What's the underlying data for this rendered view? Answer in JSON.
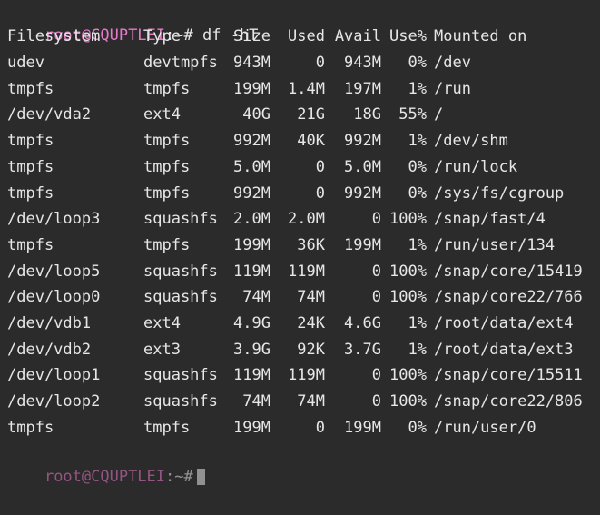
{
  "prompt": {
    "user_host": "root@CQUPTLEI",
    "separator": ":~",
    "symbol": "#",
    "command": "df -hT"
  },
  "table": {
    "headers": [
      "Filesystem",
      "Type",
      "Size",
      "Used",
      "Avail",
      "Use%",
      "Mounted on"
    ],
    "rows": [
      [
        "udev",
        "devtmpfs",
        "943M",
        "0",
        "943M",
        "0%",
        "/dev"
      ],
      [
        "tmpfs",
        "tmpfs",
        "199M",
        "1.4M",
        "197M",
        "1%",
        "/run"
      ],
      [
        "/dev/vda2",
        "ext4",
        "40G",
        "21G",
        "18G",
        "55%",
        "/"
      ],
      [
        "tmpfs",
        "tmpfs",
        "992M",
        "40K",
        "992M",
        "1%",
        "/dev/shm"
      ],
      [
        "tmpfs",
        "tmpfs",
        "5.0M",
        "0",
        "5.0M",
        "0%",
        "/run/lock"
      ],
      [
        "tmpfs",
        "tmpfs",
        "992M",
        "0",
        "992M",
        "0%",
        "/sys/fs/cgroup"
      ],
      [
        "/dev/loop3",
        "squashfs",
        "2.0M",
        "2.0M",
        "0",
        "100%",
        "/snap/fast/4"
      ],
      [
        "tmpfs",
        "tmpfs",
        "199M",
        "36K",
        "199M",
        "1%",
        "/run/user/134"
      ],
      [
        "/dev/loop5",
        "squashfs",
        "119M",
        "119M",
        "0",
        "100%",
        "/snap/core/15419"
      ],
      [
        "/dev/loop0",
        "squashfs",
        "74M",
        "74M",
        "0",
        "100%",
        "/snap/core22/766"
      ],
      [
        "/dev/vdb1",
        "ext4",
        "4.9G",
        "24K",
        "4.6G",
        "1%",
        "/root/data/ext4"
      ],
      [
        "/dev/vdb2",
        "ext3",
        "3.9G",
        "92K",
        "3.7G",
        "1%",
        "/root/data/ext3"
      ],
      [
        "/dev/loop1",
        "squashfs",
        "119M",
        "119M",
        "0",
        "100%",
        "/snap/core/15511"
      ],
      [
        "/dev/loop2",
        "squashfs",
        "74M",
        "74M",
        "0",
        "100%",
        "/snap/core22/806"
      ],
      [
        "tmpfs",
        "tmpfs",
        "199M",
        "0",
        "199M",
        "0%",
        "/run/user/0"
      ]
    ]
  },
  "next_prompt": {
    "user_host": "root@CQUPTLEI",
    "separator": ":~",
    "symbol": "#"
  },
  "colors": {
    "background": "#2b2b2b",
    "text": "#e6e6e6",
    "prompt_user": "#e879c9"
  }
}
